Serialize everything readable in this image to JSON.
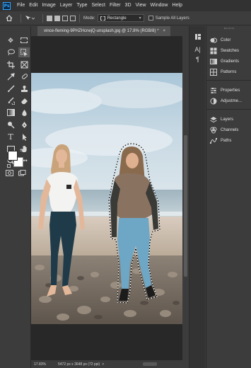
{
  "menu": {
    "logo": "Ps",
    "items": [
      "File",
      "Edit",
      "Image",
      "Layer",
      "Type",
      "Select",
      "Filter",
      "3D",
      "View",
      "Window",
      "Help"
    ]
  },
  "options_bar": {
    "mode_label": "Mode:",
    "mode_value": "Rectangle",
    "sample_all_layers": "Sample All Layers"
  },
  "document": {
    "tab_title": "vince-fleming-9PHZHcnejQ-unsplash.jpg @ 17.8% (RGB/8) *",
    "close": "×"
  },
  "status": {
    "zoom": "17.83%",
    "info": "5472 px x 3648 px (72 ppi)",
    "arrow": ">"
  },
  "panels": {
    "group1": [
      "Color",
      "Swatches",
      "Gradients",
      "Patterns"
    ],
    "group2": [
      "Properties",
      "Adjustme..."
    ],
    "group3": [
      "Layers",
      "Channels",
      "Paths"
    ]
  },
  "colors": {
    "menubar_bg": "#323232",
    "panel_bg": "#3c3c3c",
    "canvas_bg": "#282828",
    "accent_ps": "#31a8ff"
  }
}
